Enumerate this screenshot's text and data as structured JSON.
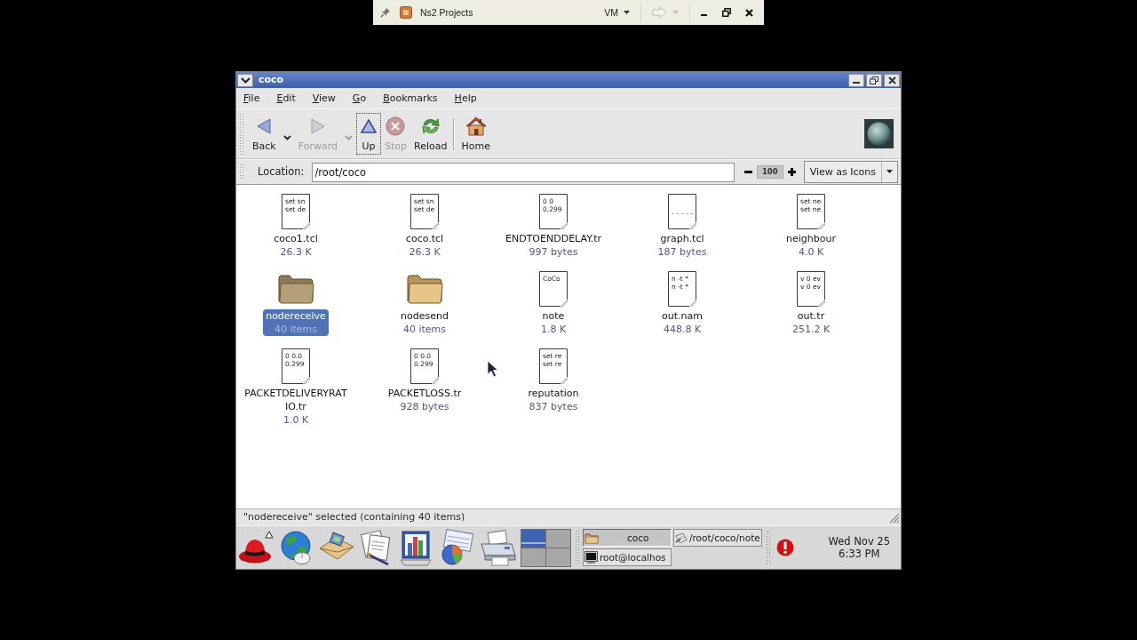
{
  "vm_bar": {
    "title": "Ns2 Projects",
    "menu": "VM",
    "forward_disabled": true
  },
  "window": {
    "title": "coco"
  },
  "menu": [
    {
      "label": "File",
      "mnemonic_underlined": true
    },
    {
      "label": "Edit",
      "mnemonic_underlined": true
    },
    {
      "label": "View",
      "mnemonic_underlined": true
    },
    {
      "label": "Go",
      "mnemonic_underlined": true
    },
    {
      "label": "Bookmarks",
      "mnemonic_underlined": true
    },
    {
      "label": "Help",
      "mnemonic_underlined": true
    }
  ],
  "toolbar": [
    {
      "kind": "back",
      "label": "Back",
      "disabled": false,
      "focused": false,
      "dropdown": true,
      "separator_before": false
    },
    {
      "kind": "forward",
      "label": "Forward",
      "disabled": true,
      "focused": false,
      "dropdown": true,
      "separator_before": false
    },
    {
      "kind": "up",
      "label": "Up",
      "disabled": false,
      "focused": true,
      "dropdown": false,
      "separator_before": false
    },
    {
      "kind": "stop",
      "label": "Stop",
      "disabled": true,
      "focused": false,
      "dropdown": false,
      "separator_before": false
    },
    {
      "kind": "reload",
      "label": "Reload",
      "disabled": false,
      "focused": false,
      "dropdown": false,
      "separator_before": false
    },
    {
      "kind": "home",
      "label": "Home",
      "disabled": false,
      "focused": false,
      "dropdown": false,
      "separator_before": true
    }
  ],
  "location": {
    "label": "Location:",
    "value": "/root/coco",
    "zoom": "100",
    "view_mode": "View as Icons"
  },
  "items": [
    {
      "kind": "file",
      "name": "coco1.tcl",
      "size": "26.3 K",
      "selected": false,
      "preview": [
        "set sn",
        "set de"
      ]
    },
    {
      "kind": "file",
      "name": "coco.tcl",
      "size": "26.3 K",
      "selected": false,
      "preview": [
        "set sn",
        "set de"
      ]
    },
    {
      "kind": "file",
      "name": "ENDTOENDDELAY.tr",
      "size": "997 bytes",
      "selected": false,
      "preview": [
        "0 0",
        "0.299"
      ]
    },
    {
      "kind": "file",
      "name": "graph.tcl",
      "size": "187 bytes",
      "selected": false
    },
    {
      "kind": "file",
      "name": "neighbour",
      "size": "4.0 K",
      "selected": false,
      "preview": [
        "set ne",
        "set ne"
      ]
    },
    {
      "kind": "folder",
      "name": "nodereceive",
      "size": "40 items",
      "selected": true
    },
    {
      "kind": "folder",
      "name": "nodesend",
      "size": "40 items",
      "selected": false
    },
    {
      "kind": "file",
      "name": "note",
      "size": "1.8 K",
      "selected": false,
      "preview": [
        "CoCo"
      ]
    },
    {
      "kind": "file",
      "name": "out.nam",
      "size": "448.8 K",
      "selected": false,
      "preview": [
        "n -t *",
        "n -t *"
      ]
    },
    {
      "kind": "file",
      "name": "out.tr",
      "size": "251.2 K",
      "selected": false,
      "preview": [
        "v 0 ev",
        "v 0 ev"
      ]
    },
    {
      "kind": "file",
      "name": "PACKETDELIVERYRATIO.tr",
      "size": "1.0 K",
      "selected": false,
      "preview": [
        "0 0.0",
        "0.299"
      ]
    },
    {
      "kind": "file",
      "name": "PACKETLOSS.tr",
      "size": "928 bytes",
      "selected": false,
      "preview": [
        "0 0.0",
        "0.299"
      ]
    },
    {
      "kind": "file",
      "name": "reputation",
      "size": "837 bytes",
      "selected": false,
      "preview": [
        "set re",
        "set re"
      ]
    }
  ],
  "status_bar": "\"nodereceive\" selected (containing 40 items)",
  "launchers": [
    {
      "kind": "hat"
    },
    {
      "kind": "globe"
    },
    {
      "kind": "mail"
    },
    {
      "kind": "documents"
    },
    {
      "kind": "chart"
    },
    {
      "kind": "presentation"
    },
    {
      "kind": "printer"
    }
  ],
  "workspaces": [
    {
      "selected": true
    },
    {
      "selected": false
    },
    {
      "selected": false
    },
    {
      "selected": false
    }
  ],
  "tasks": [
    {
      "kind": "folder",
      "label": "coco",
      "selected": true
    },
    {
      "kind": "editor",
      "label": "/root/coco/note",
      "selected": false
    },
    {
      "kind": "terminal",
      "label": "root@localhos",
      "selected": false
    }
  ],
  "clock": {
    "date": "Wed Nov 25",
    "time": "6:33 PM"
  }
}
